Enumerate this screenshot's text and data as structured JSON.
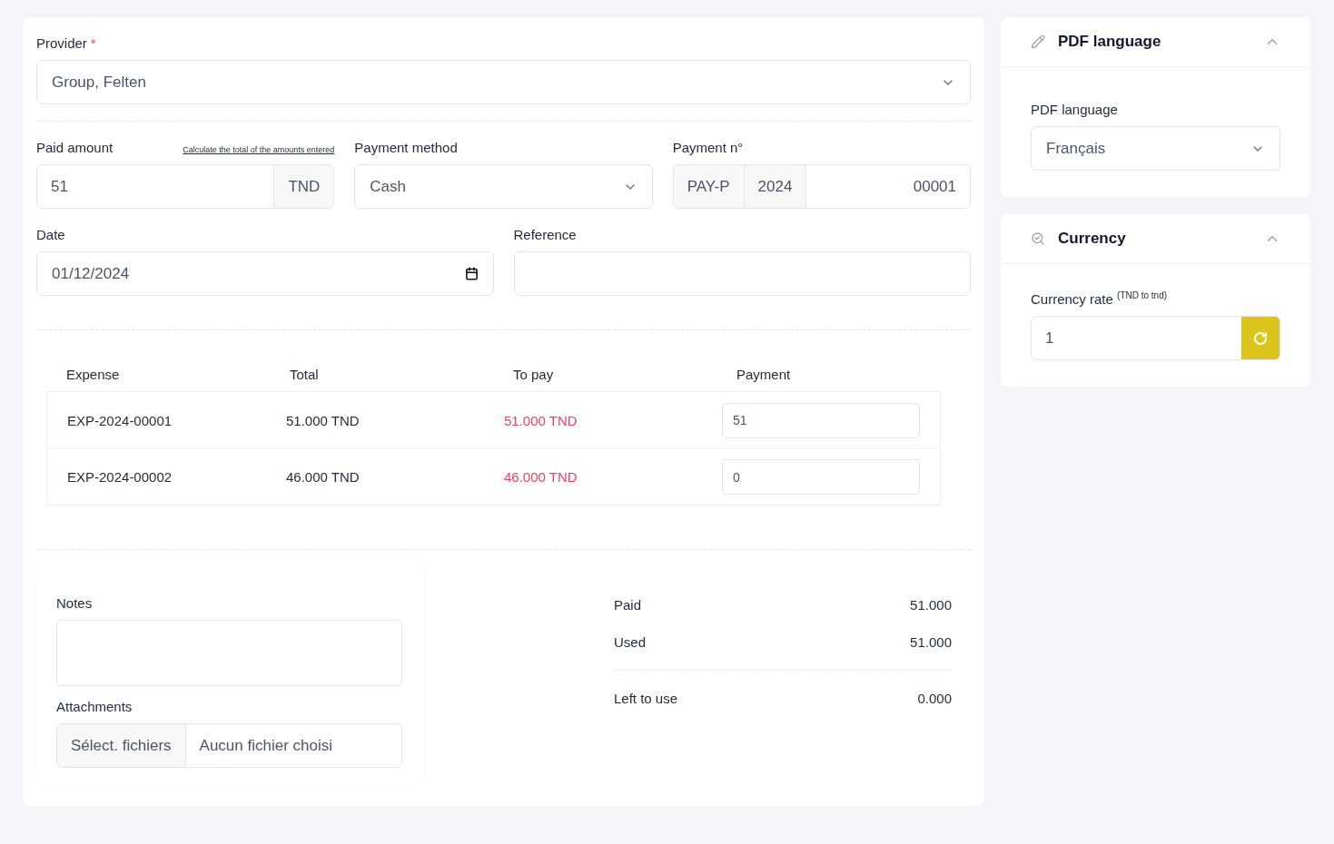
{
  "provider": {
    "label": "Provider",
    "required_mark": "*",
    "value": "Group, Felten"
  },
  "paid_amount": {
    "label": "Paid amount",
    "link": "Calculate the total of the amounts entered",
    "value": "51",
    "currency": "TND"
  },
  "payment_method": {
    "label": "Payment method",
    "value": "Cash"
  },
  "payment_number": {
    "label": "Payment n°",
    "prefix": "PAY-P",
    "year": "2024",
    "value": "00001"
  },
  "date": {
    "label": "Date",
    "value": "01/12/2024"
  },
  "reference": {
    "label": "Reference"
  },
  "table": {
    "columns": [
      "Expense",
      "Total",
      "To pay",
      "Payment"
    ],
    "rows": [
      {
        "expense": "EXP-2024-00001",
        "total": "51.000 TND",
        "to_pay": "51.000 TND",
        "payment": "51"
      },
      {
        "expense": "EXP-2024-00002",
        "total": "46.000 TND",
        "to_pay": "46.000 TND",
        "payment": "0"
      }
    ]
  },
  "notes": {
    "label": "Notes"
  },
  "attachments": {
    "label": "Attachments",
    "button": "Sélect. fichiers",
    "status": "Aucun fichier choisi"
  },
  "summary": [
    {
      "label": "Paid",
      "value": "51.000",
      "divider_after": false
    },
    {
      "label": "Used",
      "value": "51.000",
      "divider_after": true
    },
    {
      "label": "Left to use",
      "value": "0.000",
      "divider_after": false
    }
  ],
  "panels": [
    {
      "kind": "language",
      "title": "PDF language",
      "expanded": true,
      "field_label": "PDF language",
      "value": "Français"
    },
    {
      "kind": "currency",
      "title": "Currency",
      "expanded": true,
      "field_label": "Currency rate",
      "field_note": "(TND to tnd)",
      "value": "1"
    }
  ]
}
